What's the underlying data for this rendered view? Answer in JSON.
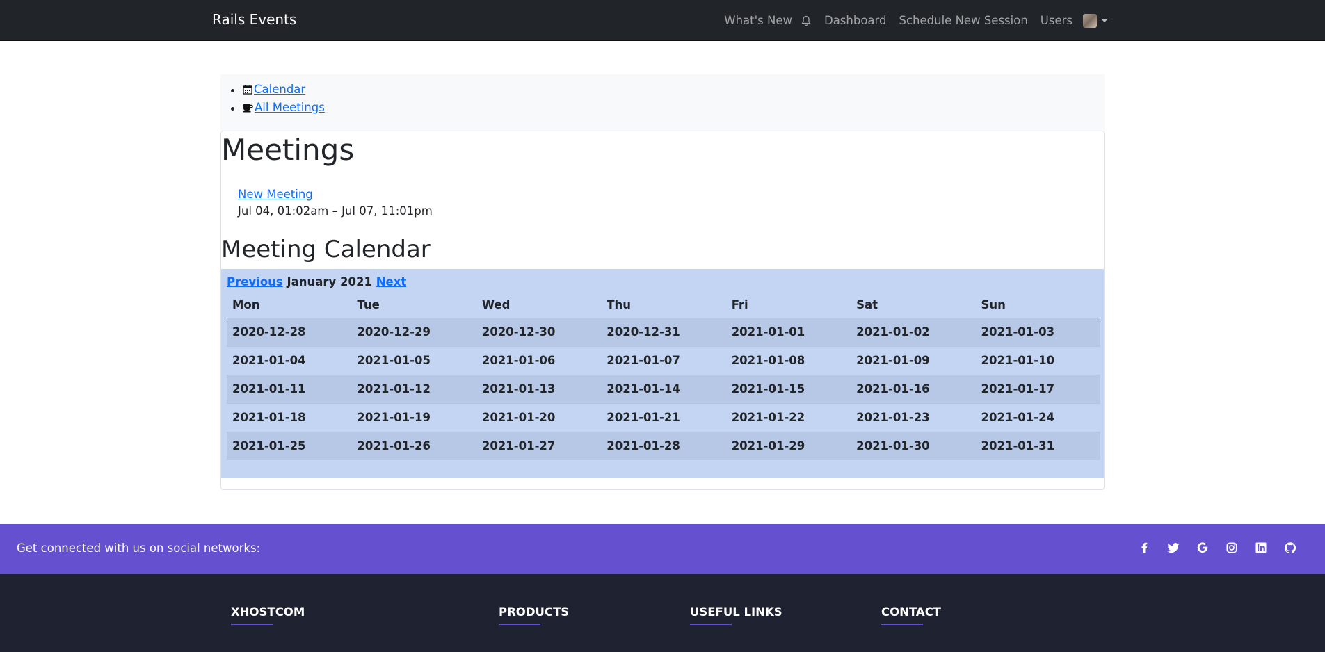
{
  "navbar": {
    "brand": "Rails Events",
    "links": {
      "whats_new": "What's New",
      "dashboard": "Dashboard",
      "schedule": "Schedule New Session",
      "users": "Users"
    }
  },
  "subnav": {
    "items": [
      {
        "label": "Calendar",
        "icon": "calendar-icon"
      },
      {
        "label": "All Meetings",
        "icon": "coffee-cup-icon"
      }
    ]
  },
  "page": {
    "title": "Meetings",
    "new_meeting": "New Meeting",
    "meeting_range": "Jul 04, 01:02am – Jul 07, 11:01pm",
    "calendar_title": "Meeting Calendar"
  },
  "calendar": {
    "prev": "Previous",
    "month": "January 2021",
    "next": "Next",
    "weekdays": [
      "Mon",
      "Tue",
      "Wed",
      "Thu",
      "Fri",
      "Sat",
      "Sun"
    ],
    "weeks": [
      [
        "2020-12-28",
        "2020-12-29",
        "2020-12-30",
        "2020-12-31",
        "2021-01-01",
        "2021-01-02",
        "2021-01-03"
      ],
      [
        "2021-01-04",
        "2021-01-05",
        "2021-01-06",
        "2021-01-07",
        "2021-01-08",
        "2021-01-09",
        "2021-01-10"
      ],
      [
        "2021-01-11",
        "2021-01-12",
        "2021-01-13",
        "2021-01-14",
        "2021-01-15",
        "2021-01-16",
        "2021-01-17"
      ],
      [
        "2021-01-18",
        "2021-01-19",
        "2021-01-20",
        "2021-01-21",
        "2021-01-22",
        "2021-01-23",
        "2021-01-24"
      ],
      [
        "2021-01-25",
        "2021-01-26",
        "2021-01-27",
        "2021-01-28",
        "2021-01-29",
        "2021-01-30",
        "2021-01-31"
      ]
    ]
  },
  "social": {
    "text": "Get connected with us on social networks:",
    "icons": [
      "facebook-icon",
      "twitter-icon",
      "google-icon",
      "instagram-icon",
      "linkedin-icon",
      "github-icon"
    ]
  },
  "footer": {
    "columns": [
      "XHOSTCOM",
      "PRODUCTS",
      "USEFUL LINKS",
      "CONTACT"
    ]
  },
  "colors": {
    "navbar_bg": "#212529",
    "social_bg": "#6551d0",
    "footer_bg": "#1f2230",
    "calendar_bg": "#c4d5f3",
    "link": "#0d6efd"
  }
}
